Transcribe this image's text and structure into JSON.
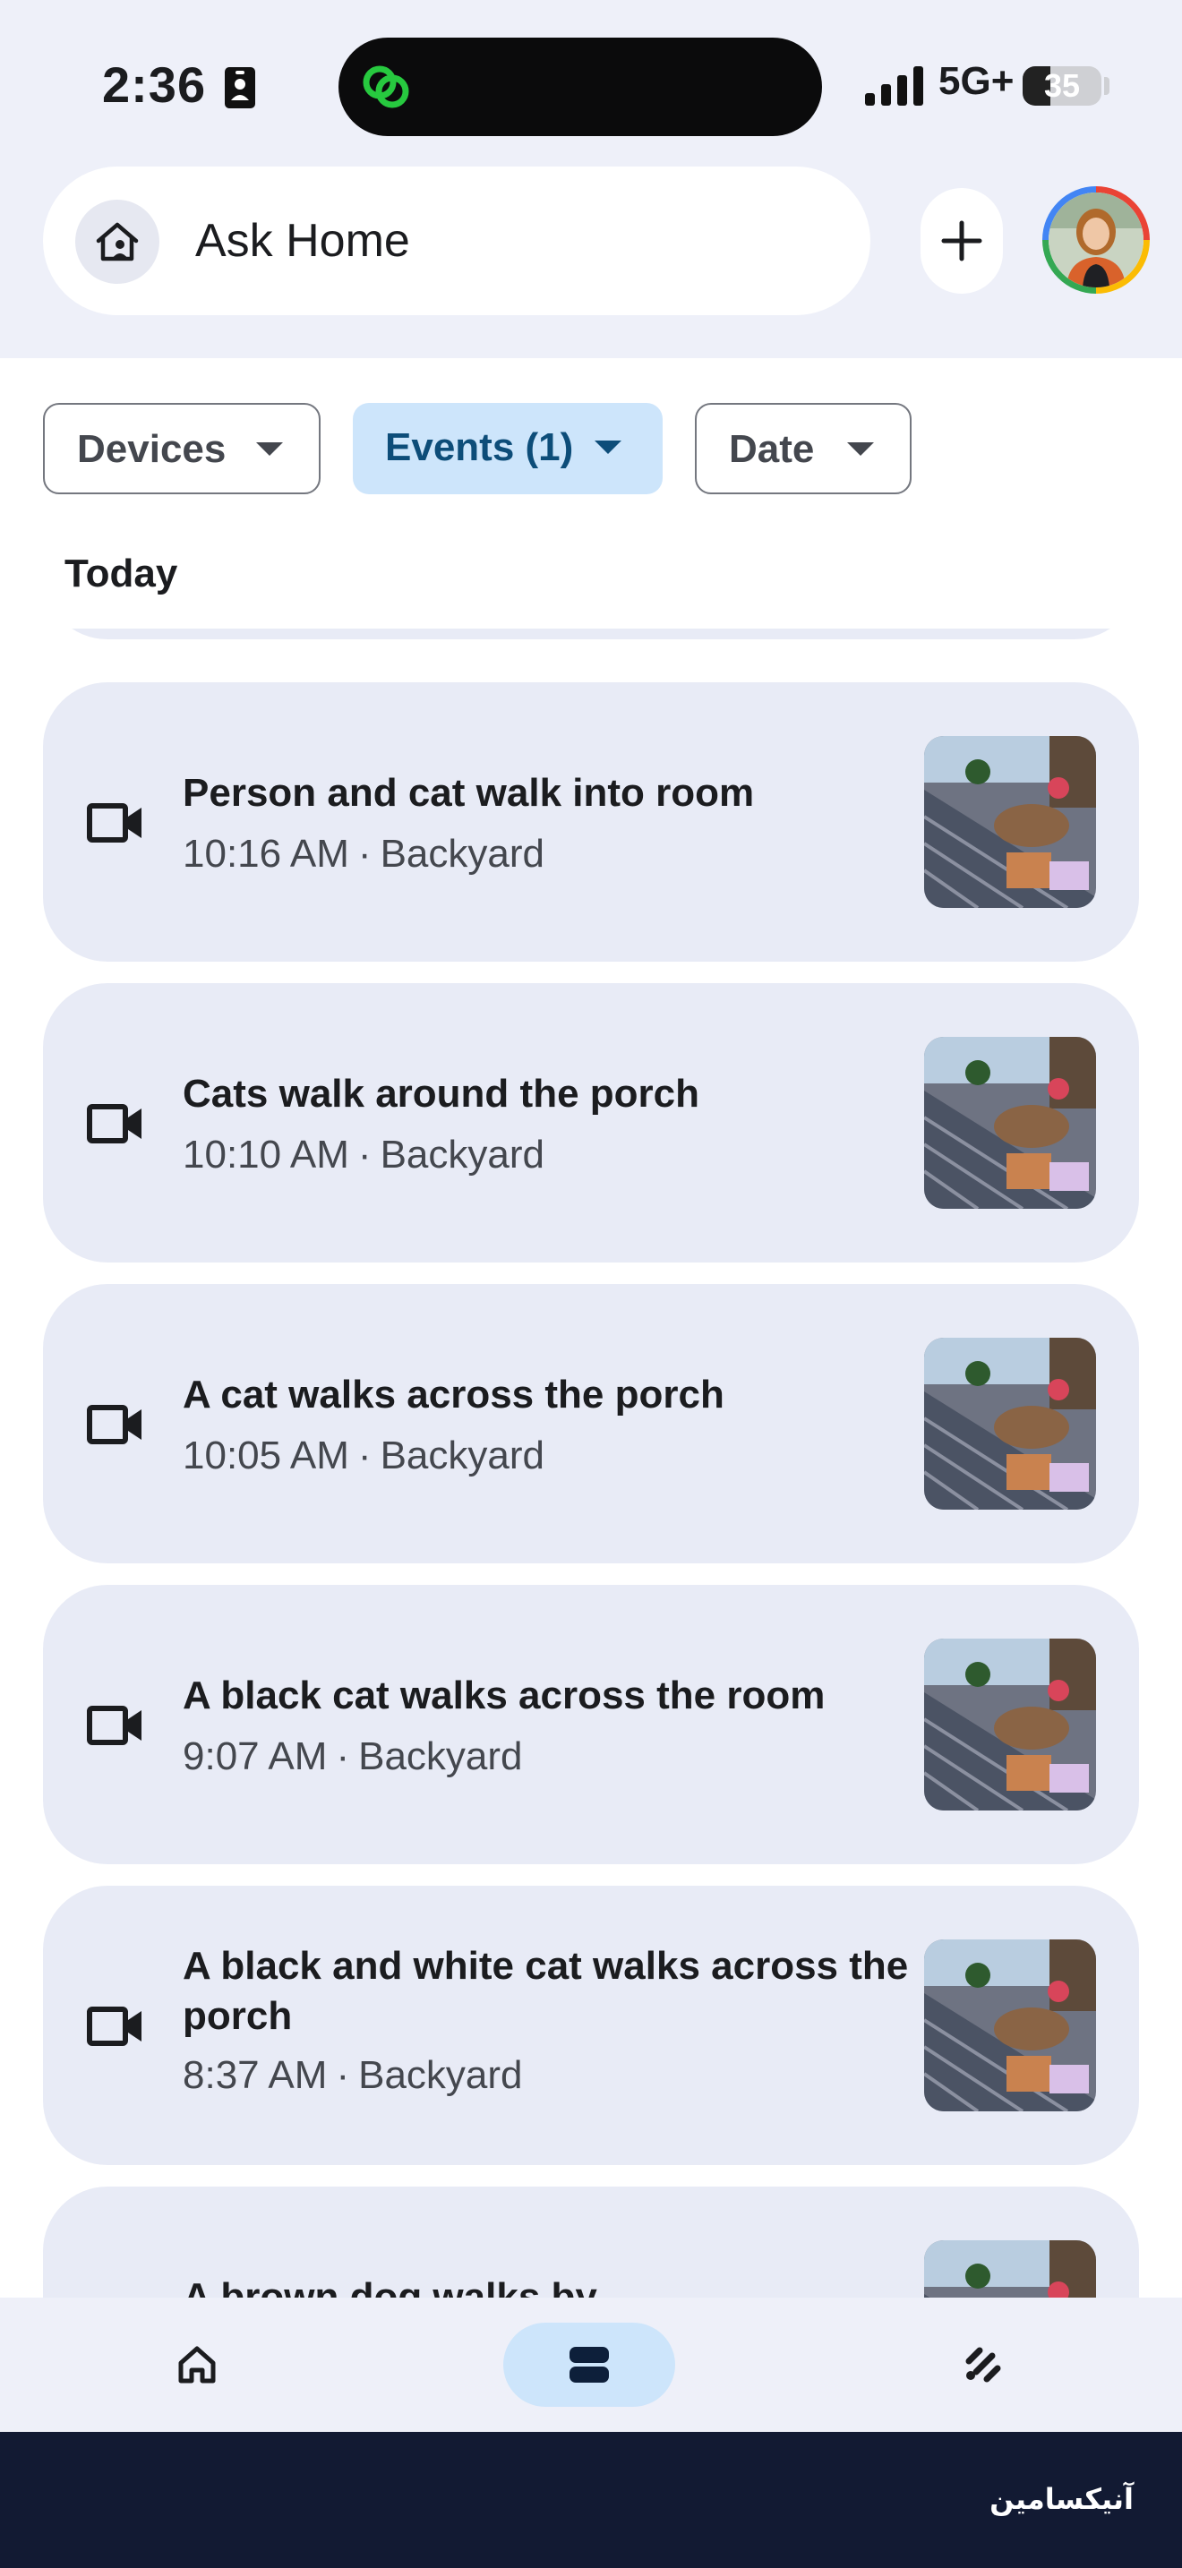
{
  "status_bar": {
    "time": "2:36",
    "network": "5G+",
    "battery": "35",
    "battery_level": 0.35
  },
  "header": {
    "search_label": "Ask Home",
    "icons": {
      "search": "home-person-icon",
      "add": "plus-icon",
      "avatar": "profile-avatar"
    }
  },
  "filters": [
    {
      "label": "Devices",
      "active": false
    },
    {
      "label": "Events (1)",
      "active": true
    },
    {
      "label": "Date",
      "active": false
    }
  ],
  "section_title": "Today",
  "events": [
    {
      "title": "Person and cat walk into room",
      "time": "10:16 AM",
      "separator": "·",
      "location": "Backyard",
      "icon": "video-camera-icon"
    },
    {
      "title": "Cats walk around the porch",
      "time": "10:10 AM",
      "separator": "·",
      "location": "Backyard",
      "icon": "video-camera-icon"
    },
    {
      "title": "A cat walks across the porch",
      "time": "10:05 AM",
      "separator": "·",
      "location": "Backyard",
      "icon": "video-camera-icon"
    },
    {
      "title": "A black cat walks across the room",
      "time": "9:07 AM",
      "separator": "·",
      "location": "Backyard",
      "icon": "video-camera-icon"
    },
    {
      "title": "A black and white cat walks across the porch",
      "time": "8:37 AM",
      "separator": "·",
      "location": "Backyard",
      "icon": "video-camera-icon"
    },
    {
      "title": "A brown dog walks by",
      "icon": "video-camera-icon"
    }
  ],
  "bottom_nav": {
    "items": [
      {
        "icon": "home-icon",
        "active": false
      },
      {
        "icon": "activity-icon",
        "active": true
      },
      {
        "icon": "automations-icon",
        "active": false
      }
    ]
  },
  "watermark": "آنیکسامین",
  "colors": {
    "surface": "#eef0f9",
    "card": "#e8ebf6",
    "active_chip": "#cde5fb",
    "active_text": "#0d4d79",
    "footer": "#121a33"
  }
}
